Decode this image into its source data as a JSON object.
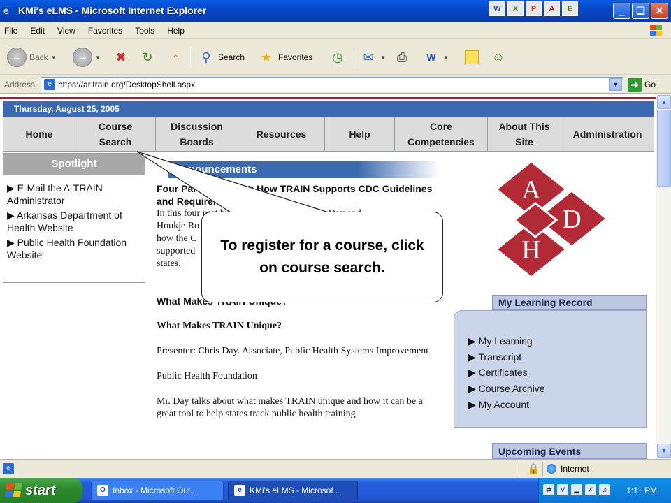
{
  "window": {
    "title": "KMi's eLMS - Microsoft Internet Explorer",
    "tray_app_glyphs": [
      "W",
      "X",
      "P",
      "A",
      "E"
    ],
    "buttons": [
      "_",
      "❏",
      "✕"
    ]
  },
  "menu": [
    "File",
    "Edit",
    "View",
    "Favorites",
    "Tools",
    "Help"
  ],
  "toolbar": {
    "back_label": "Back",
    "search_label": "Search",
    "favorites_label": "Favorites"
  },
  "address": {
    "label": "Address",
    "url": "https://ar.train.org/DesktopShell.aspx",
    "go_label": "Go"
  },
  "page": {
    "date": "Thursday, August 25, 2005",
    "nav_tabs": [
      "Home",
      "Course\nSearch",
      "Discussion\nBoards",
      "Resources",
      "Help",
      "Core\nCompetencies",
      "About This\nSite",
      "Administration"
    ],
    "spotlight": {
      "title": "Spotlight",
      "items": [
        "▶ E-Mail the A-TRAIN Administrator",
        "▶ Arkansas Department of Health Website",
        "▶ Public Health Foundation Website"
      ]
    },
    "announcements": {
      "title": "Announcements",
      "headline": "Four Part Broadcast: How TRAIN Supports CDC Guidelines and Requirements",
      "intro_lines": [
        "In this four part broadcast, presenters Chris Day and",
        "Houkje Ro",
        "how the C",
        "supported",
        "states."
      ],
      "section_heading": "What Makes TRAIN Unique?",
      "bold_heading": "What Makes TRAIN Unique?",
      "presenter": "Presenter: Chris Day. Associate, Public Health Systems Improvement",
      "org": "Public Health Foundation",
      "description": "Mr. Day talks about what makes TRAIN unique and how it can be a great tool to help states track public health training"
    },
    "logo": {
      "letters": [
        "A",
        "D",
        "H"
      ],
      "color": "#b22a35"
    },
    "learning_record": {
      "title": "My Learning Record",
      "items": [
        "▶ My Learning",
        "▶ Transcript",
        "▶ Certificates",
        "▶ Course Archive",
        "▶ My Account"
      ]
    },
    "upcoming_events": {
      "title": "Upcoming Events"
    }
  },
  "callout": {
    "text": "To register for a course, click on course search."
  },
  "status": {
    "zone": "Internet"
  },
  "taskbar": {
    "start_label": "start",
    "tasks": [
      "Inbox - Microsoft Out...",
      "KMi's eLMS - Microsof..."
    ],
    "clock": "1:11 PM"
  },
  "colors": {
    "nav_blue": "#3b6ab0",
    "spotlight_gray": "#a8a8a8",
    "learning_record_bg": "#cbd5ea",
    "title_blue": "#0548c8",
    "start_green": "#2d8a2d"
  }
}
